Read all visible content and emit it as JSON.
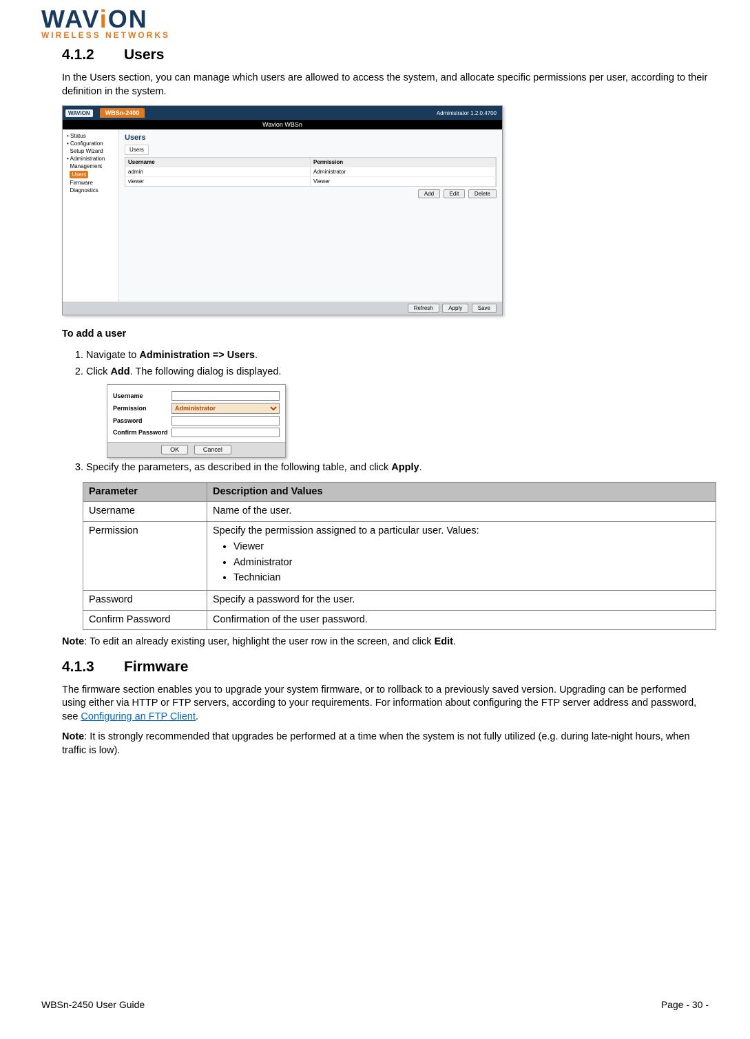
{
  "logo": {
    "sub": "WIRELESS NETWORKS"
  },
  "sec412": {
    "num": "4.1.2",
    "title": "Users",
    "intro": "In the Users section, you can manage which users are allowed to access the system, and allocate specific permissions per user, according to their definition in the system.",
    "shot": {
      "product": "WBSn-2400",
      "topright": "Administrator 1.2.0.4700",
      "bar": "Wavion WBSn",
      "nav": [
        "Status",
        "Configuration",
        "Setup Wizard",
        "Administration",
        "Management",
        "Users",
        "Firmware",
        "Diagnostics"
      ],
      "users_title": "Users",
      "tab": "Users",
      "cols": [
        "Username",
        "Permission"
      ],
      "rows": [
        [
          "admin",
          "Administrator"
        ],
        [
          "viewer",
          "Viewer"
        ]
      ],
      "btns": [
        "Add",
        "Edit",
        "Delete"
      ],
      "footer": [
        "Refresh",
        "Apply",
        "Save"
      ]
    },
    "add_title": "To add a user",
    "step1_a": "Navigate to ",
    "step1_b": "Administration => Users",
    "step1_c": ".",
    "step2_a": "Click ",
    "step2_b": "Add",
    "step2_c": ". The following dialog is displayed.",
    "dialog": {
      "username": "Username",
      "permission": "Permission",
      "permission_val": "Administrator",
      "password": "Password",
      "confirm": "Confirm Password",
      "ok": "OK",
      "cancel": "Cancel"
    },
    "step3_a": "Specify the parameters, as described in the following table, and click ",
    "step3_b": "Apply",
    "step3_c": ".",
    "tbl": {
      "h1": "Parameter",
      "h2": "Description and Values",
      "r1p": "Username",
      "r1d": "Name of the user.",
      "r2p": "Permission",
      "r2d": "Specify the permission assigned to a particular user. Values:",
      "r2v": [
        "Viewer",
        "Administrator",
        "Technician"
      ],
      "r3p": "Password",
      "r3d": "Specify a password for the user.",
      "r4p": "Confirm Password",
      "r4d": "Confirmation of the user password."
    },
    "note_a": "Note",
    "note_b": ": To edit an already existing user, highlight the user row in the screen, and click ",
    "note_c": "Edit",
    "note_d": "."
  },
  "sec413": {
    "num": "4.1.3",
    "title": "Firmware",
    "p1_a": "The firmware section enables you to upgrade your system firmware, or to rollback to a previously saved version. Upgrading can be performed using either via HTTP or FTP servers, according to your requirements. For information about configuring the FTP server address and password, see ",
    "p1_link": "Configuring an FTP Client",
    "p1_b": ".",
    "note_a": "Note",
    "note_b": ": It is strongly recommended that upgrades be performed at a time when the system is not fully utilized (e.g. during late-night hours, when traffic is low)."
  },
  "footer": {
    "left": "WBSn-2450 User Guide",
    "right": "Page - 30 -"
  }
}
